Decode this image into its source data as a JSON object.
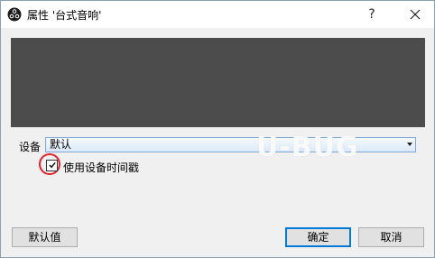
{
  "window": {
    "title": "属性 '台式音响'",
    "help_glyph": "?"
  },
  "device": {
    "label": "设备",
    "selected_value": "默认"
  },
  "timestamp_option": {
    "label": "使用设备时间戳",
    "checked": true
  },
  "watermark": {
    "text": "U-BUG"
  },
  "buttons": {
    "defaults_label": "默认值",
    "ok_label": "确定",
    "cancel_label": "取消"
  },
  "colors": {
    "preview_background": "#4c4c4c",
    "highlight_circle": "#e0232c",
    "ok_border": "#0078d7"
  },
  "icons": {
    "app": "obs-logo-icon",
    "help": "help-icon",
    "close": "close-icon",
    "dropdown": "chevron-down-icon",
    "check": "checkmark-icon"
  }
}
